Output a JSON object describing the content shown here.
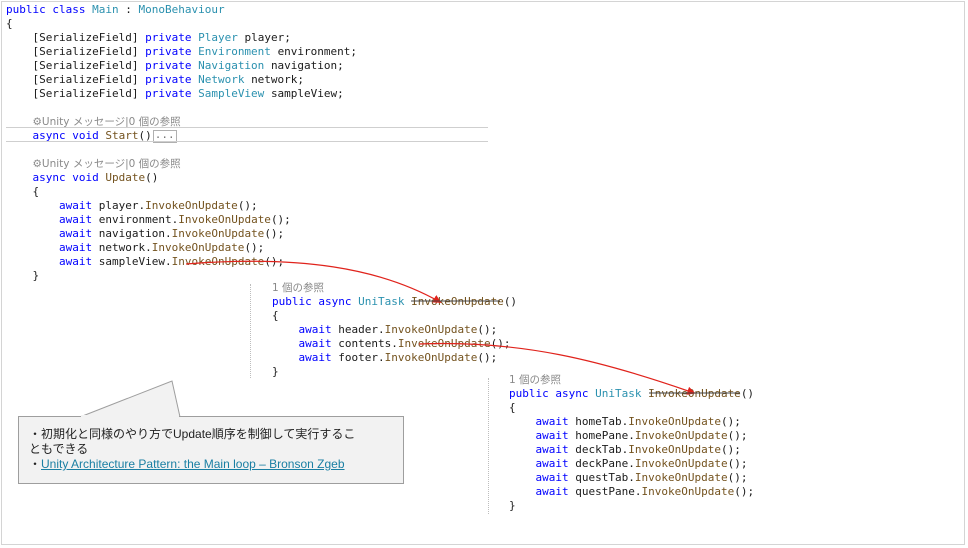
{
  "main_class": {
    "header": {
      "kw": "public class",
      "name": "Main",
      "sep": " : ",
      "base": "MonoBehaviour"
    },
    "open_brace": "{",
    "fields": [
      {
        "attr": "[SerializeField]",
        "kw": "private",
        "type": "Player",
        "name": "player;"
      },
      {
        "attr": "[SerializeField]",
        "kw": "private",
        "type": "Environment",
        "name": "environment;"
      },
      {
        "attr": "[SerializeField]",
        "kw": "private",
        "type": "Navigation",
        "name": "navigation;"
      },
      {
        "attr": "[SerializeField]",
        "kw": "private",
        "type": "Network",
        "name": "network;"
      },
      {
        "attr": "[SerializeField]",
        "kw": "private",
        "type": "SampleView",
        "name": "sampleView;"
      }
    ],
    "start_ref": "⚙Unity メッセージ|0 個の参照",
    "start_sig_kw": "async void",
    "start_sig_name": "Start",
    "start_sig_tail": "()",
    "collapsed": "...",
    "update_ref": "⚙Unity メッセージ|0 個の参照",
    "update_sig_kw": "async void",
    "update_sig_name": "Update",
    "update_sig_tail": "()",
    "update_open": "{",
    "update_lines": [
      {
        "kw": "await",
        "obj": "player.",
        "method": "InvokeOnUpdate",
        "tail": "();"
      },
      {
        "kw": "await",
        "obj": "environment.",
        "method": "InvokeOnUpdate",
        "tail": "();"
      },
      {
        "kw": "await",
        "obj": "navigation.",
        "method": "InvokeOnUpdate",
        "tail": "();"
      },
      {
        "kw": "await",
        "obj": "network.",
        "method": "InvokeOnUpdate",
        "tail": "();"
      },
      {
        "kw": "await",
        "obj": "sampleView.",
        "method": "InvokeOnUpdate",
        "tail": "();"
      }
    ],
    "update_close": "}"
  },
  "sample_view": {
    "ref": "1 個の参照",
    "sig_kw": "public async",
    "sig_type": "UniTask",
    "sig_name": "InvokeOnUpdate",
    "sig_tail": "()",
    "open": "{",
    "lines": [
      {
        "kw": "await",
        "obj": "header.",
        "method": "InvokeOnUpdate",
        "tail": "();"
      },
      {
        "kw": "await",
        "obj": "contents.",
        "method": "InvokeOnUpdate",
        "tail": "();"
      },
      {
        "kw": "await",
        "obj": "footer.",
        "method": "InvokeOnUpdate",
        "tail": "();"
      }
    ],
    "close": "}"
  },
  "contents": {
    "ref": "1 個の参照",
    "sig_kw": "public async",
    "sig_type": "UniTask",
    "sig_name": "InvokeOnUpdate",
    "sig_tail": "()",
    "open": "{",
    "lines": [
      {
        "kw": "await",
        "obj": "homeTab.",
        "method": "InvokeOnUpdate",
        "tail": "();"
      },
      {
        "kw": "await",
        "obj": "homePane.",
        "method": "InvokeOnUpdate",
        "tail": "();"
      },
      {
        "kw": "await",
        "obj": "deckTab.",
        "method": "InvokeOnUpdate",
        "tail": "();"
      },
      {
        "kw": "await",
        "obj": "deckPane.",
        "method": "InvokeOnUpdate",
        "tail": "();"
      },
      {
        "kw": "await",
        "obj": "questTab.",
        "method": "InvokeOnUpdate",
        "tail": "();"
      },
      {
        "kw": "await",
        "obj": "questPane.",
        "method": "InvokeOnUpdate",
        "tail": "();"
      }
    ],
    "close": "}"
  },
  "callout": {
    "line1": "・初期化と同様のやり方でUpdate順序を制御して実行するこ",
    "line2": "ともできる",
    "bullet": "・",
    "link_text": "Unity Architecture Pattern: the Main loop – Bronson Zgeb"
  },
  "colors": {
    "keyword": "#0000ff",
    "type": "#2b91af",
    "method": "#74531f",
    "arrow": "#e0231c",
    "link": "#1a7fa3"
  }
}
